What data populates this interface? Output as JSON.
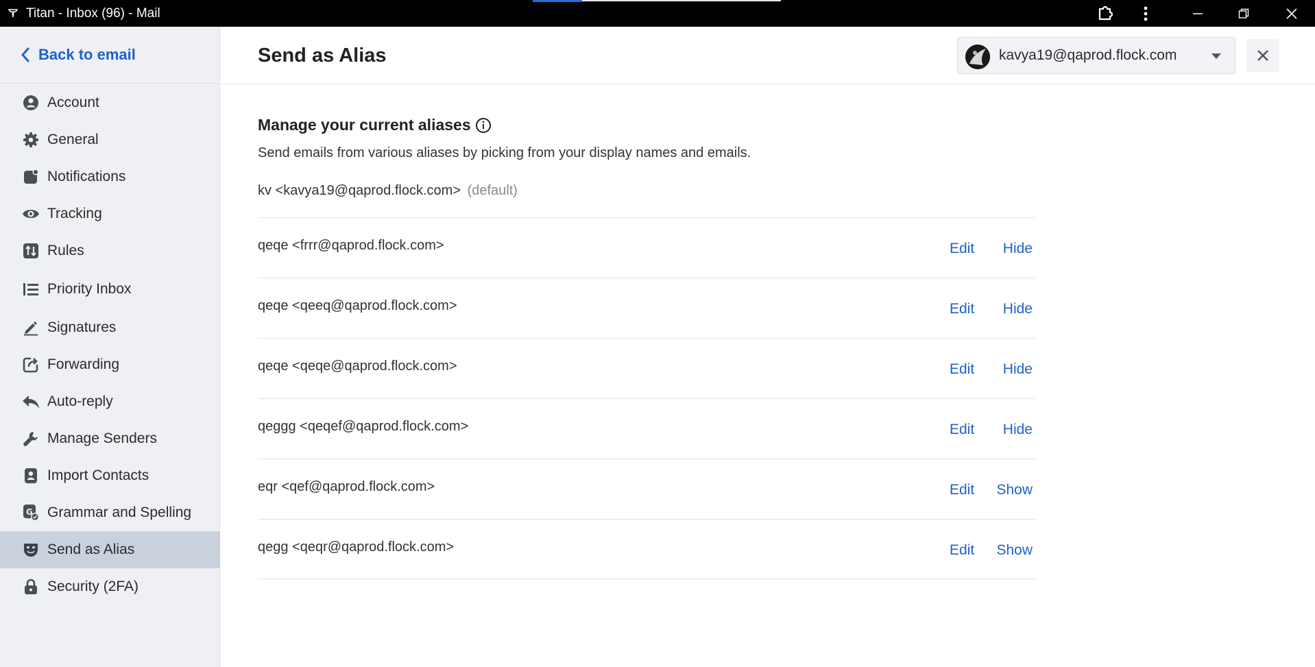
{
  "window": {
    "title": "Titan - Inbox (96) - Mail"
  },
  "sidebar": {
    "back_label": "Back to email",
    "items": [
      {
        "label": "Account",
        "icon": "user-circle-icon"
      },
      {
        "label": "General",
        "icon": "gear-icon"
      },
      {
        "label": "Notifications",
        "icon": "bell-badge-icon"
      },
      {
        "label": "Tracking",
        "icon": "eye-icon"
      },
      {
        "label": "Rules",
        "icon": "rules-icon"
      },
      {
        "label": "Priority Inbox",
        "icon": "list-priority-icon"
      },
      {
        "label": "Signatures",
        "icon": "pen-icon"
      },
      {
        "label": "Forwarding",
        "icon": "forward-icon"
      },
      {
        "label": "Auto-reply",
        "icon": "reply-icon"
      },
      {
        "label": "Manage Senders",
        "icon": "wrench-icon"
      },
      {
        "label": "Import Contacts",
        "icon": "contact-card-icon"
      },
      {
        "label": "Grammar and Spelling",
        "icon": "grammar-icon"
      },
      {
        "label": "Send as Alias",
        "icon": "mask-icon",
        "active": true
      },
      {
        "label": "Security (2FA)",
        "icon": "lock-icon"
      }
    ]
  },
  "header": {
    "title": "Send as Alias",
    "account_email": "kavya19@qaprod.flock.com"
  },
  "content": {
    "heading": "Manage your current aliases",
    "description": "Send emails from various aliases by picking from your display names and emails.",
    "default_alias": "kv <kavya19@qaprod.flock.com>",
    "default_tag": "(default)",
    "edit_label": "Edit",
    "aliases": [
      {
        "text": "qeqe <frrr@qaprod.flock.com>",
        "action": "Hide"
      },
      {
        "text": "qeqe <qeeq@qaprod.flock.com>",
        "action": "Hide"
      },
      {
        "text": "qeqe <qeqe@qaprod.flock.com>",
        "action": "Hide"
      },
      {
        "text": "qeggg <qeqef@qaprod.flock.com>",
        "action": "Hide"
      },
      {
        "text": "eqr <qef@qaprod.flock.com>",
        "action": "Show"
      },
      {
        "text": "qegg <qeqr@qaprod.flock.com>",
        "action": "Show"
      }
    ]
  },
  "colors": {
    "accent": "#1f62c9",
    "sidebar_bg": "#eef0f3",
    "sidebar_active": "#c9d1dc",
    "titlebar": "#000000"
  }
}
